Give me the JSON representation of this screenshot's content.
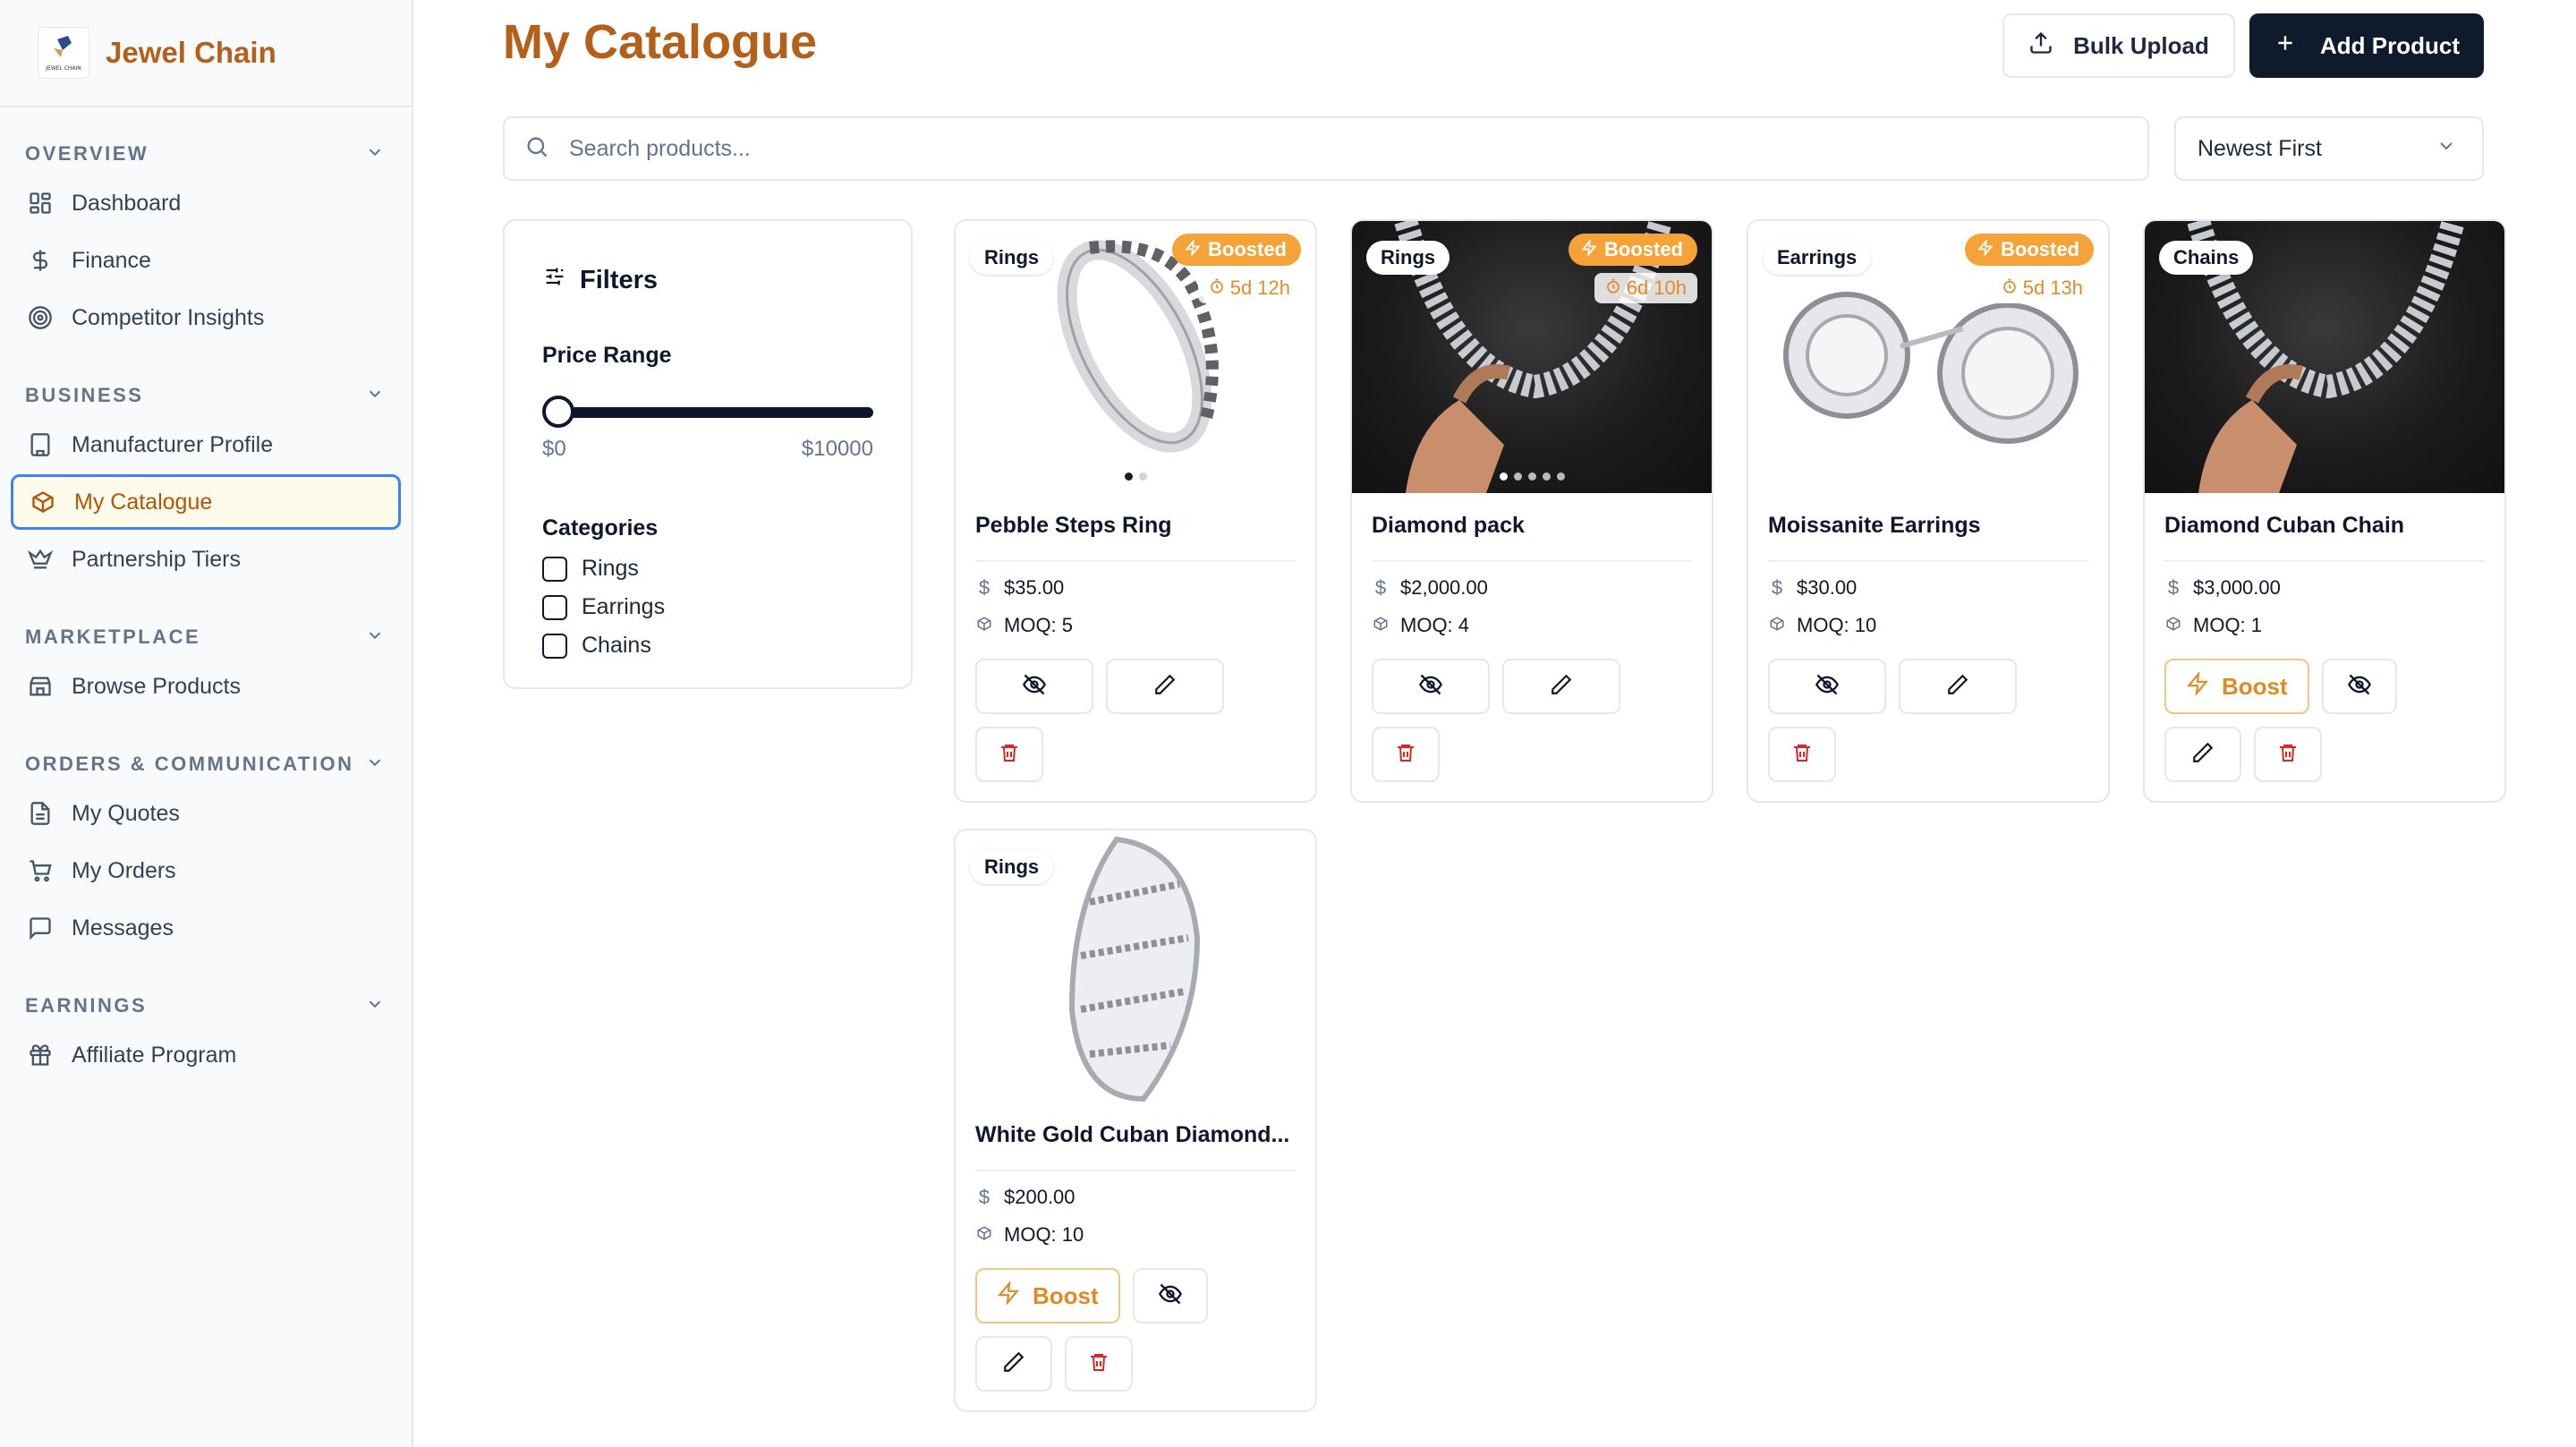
{
  "brand": {
    "name": "Jewel Chain",
    "logo_text": "JEWEL CHAIN"
  },
  "sidebar": {
    "sections": [
      {
        "title": "OVERVIEW",
        "items": [
          "Dashboard",
          "Finance",
          "Competitor Insights"
        ]
      },
      {
        "title": "BUSINESS",
        "items": [
          "Manufacturer Profile",
          "My Catalogue",
          "Partnership Tiers"
        ]
      },
      {
        "title": "MARKETPLACE",
        "items": [
          "Browse Products"
        ]
      },
      {
        "title": "ORDERS & COMMUNICATION",
        "items": [
          "My Quotes",
          "My Orders",
          "Messages"
        ]
      },
      {
        "title": "EARNINGS",
        "items": [
          "Affiliate Program"
        ]
      }
    ],
    "active_item": "My Catalogue"
  },
  "header": {
    "title": "My Catalogue",
    "bulk_upload_label": "Bulk Upload",
    "add_product_label": "Add Product"
  },
  "search": {
    "placeholder": "Search products...",
    "value": ""
  },
  "sort": {
    "selected": "Newest First"
  },
  "filters": {
    "title": "Filters",
    "price_range_label": "Price Range",
    "price_min": "$0",
    "price_max": "$10000",
    "categories_label": "Categories",
    "categories": [
      "Rings",
      "Earrings",
      "Chains"
    ]
  },
  "products": [
    {
      "name": "Pebble Steps Ring",
      "category": "Rings",
      "price": "$35.00",
      "moq": "MOQ: 5",
      "boosted": true,
      "boost_label": "Boosted",
      "timer": "5d 12h"
    },
    {
      "name": "Diamond pack",
      "category": "Rings",
      "price": "$2,000.00",
      "moq": "MOQ: 4",
      "boosted": true,
      "boost_label": "Boosted",
      "timer": "6d 10h"
    },
    {
      "name": "Moissanite Earrings",
      "category": "Earrings",
      "price": "$30.00",
      "moq": "MOQ: 10",
      "boosted": true,
      "boost_label": "Boosted",
      "timer": "5d 13h"
    },
    {
      "name": "Diamond Cuban Chain",
      "category": "Chains",
      "price": "$3,000.00",
      "moq": "MOQ: 1",
      "boosted": false,
      "boost_button_label": "Boost"
    },
    {
      "name": "White Gold Cuban Diamond...",
      "category": "Rings",
      "price": "$200.00",
      "moq": "MOQ: 10",
      "boosted": false,
      "boost_button_label": "Boost"
    }
  ],
  "colors": {
    "accent": "#b45f1a",
    "boost": "#f5a238",
    "primary_dark": "#0f1b2d",
    "delete": "#dc2626",
    "active_border": "#3b82f6"
  },
  "icons": {
    "nav": [
      "grid-icon",
      "dollar-icon",
      "target-icon",
      "building-icon",
      "box-icon",
      "crown-icon",
      "store-icon",
      "document-icon",
      "cart-icon",
      "message-icon",
      "gift-icon"
    ],
    "card_actions": [
      "eye-off-icon",
      "pencil-icon",
      "trash-icon",
      "zap-icon"
    ]
  }
}
